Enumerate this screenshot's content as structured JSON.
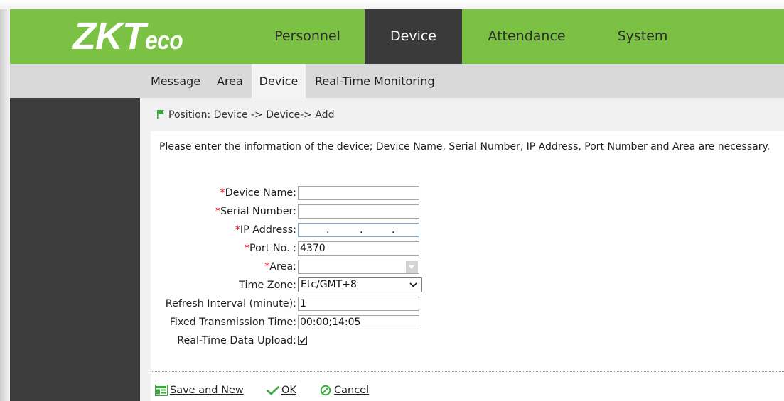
{
  "logo": {
    "main": "ZKT",
    "suffix": "eco"
  },
  "top_nav": {
    "items": [
      {
        "label": "Personnel",
        "active": false
      },
      {
        "label": "Device",
        "active": true
      },
      {
        "label": "Attendance",
        "active": false
      },
      {
        "label": "System",
        "active": false
      }
    ]
  },
  "sub_nav": {
    "items": [
      {
        "label": "Message",
        "active": false
      },
      {
        "label": "Area",
        "active": false
      },
      {
        "label": "Device",
        "active": true
      },
      {
        "label": "Real-Time Monitoring",
        "active": false
      }
    ]
  },
  "breadcrumb": {
    "text": "Position: Device -> Device-> Add",
    "icon": "flag-icon"
  },
  "info_message": "Please enter the information of the device; Device Name, Serial Number, IP Address, Port Number and Area are necessary.",
  "form": {
    "required_mark": "*",
    "fields": [
      {
        "label": "Device Name:",
        "required": true,
        "value": ""
      },
      {
        "label": "Serial Number:",
        "required": true,
        "value": ""
      },
      {
        "label": "IP Address:",
        "required": true,
        "value": "",
        "separator": "."
      },
      {
        "label": "Port No. :",
        "required": true,
        "value": "4370"
      },
      {
        "label": "Area:",
        "required": true,
        "value": ""
      },
      {
        "label": "Time Zone:",
        "required": false,
        "value": "Etc/GMT+8"
      },
      {
        "label": "Refresh Interval (minute):",
        "required": false,
        "value": "1"
      },
      {
        "label": "Fixed Transmission Time:",
        "required": false,
        "value": "00:00;14:05"
      },
      {
        "label": "Real-Time Data Upload:",
        "required": false,
        "checked": true
      }
    ]
  },
  "actions": {
    "save_and_new": {
      "label": "Save and New",
      "icon": "save-form-icon"
    },
    "ok": {
      "label": "OK",
      "icon": "check-icon"
    },
    "cancel": {
      "label": "Cancel",
      "icon": "cancel-icon"
    }
  },
  "colors": {
    "header_green": "#7bc143",
    "active_tab": "#3a3a3a",
    "subnav_bg": "#d9d9d9",
    "subnav_active_bg": "#f3f3f3",
    "sidebar": "#3c3c3c",
    "content_bg": "#f1f1f1",
    "required": "#e3001b",
    "icon_green": "#3aa83f"
  }
}
